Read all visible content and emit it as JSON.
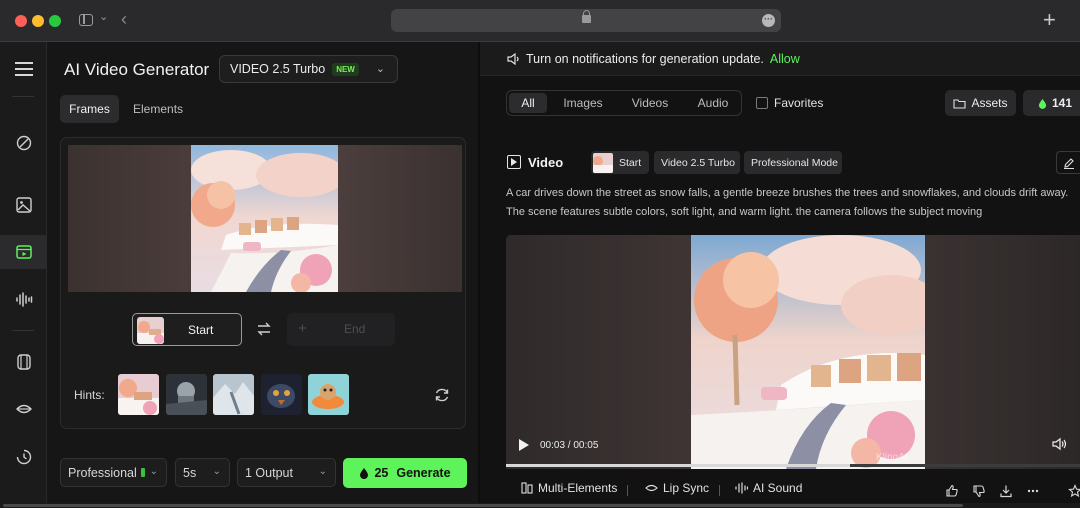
{
  "app": {
    "title": "AI Video Generator",
    "model": "VIDEO 2.5 Turbo",
    "model_badge": "NEW"
  },
  "tabs": [
    "Frames",
    "Elements"
  ],
  "frames": {
    "start_label": "Start",
    "end_label": "End",
    "hints_label": "Hints:"
  },
  "settings": {
    "mode": "Professional",
    "duration": "5s",
    "outputs": "1 Output",
    "generate_cost": "25",
    "generate_label": "Generate"
  },
  "notification": {
    "text": "Turn on notifications for generation update.",
    "action": "Allow"
  },
  "filters": {
    "tabs": [
      "All",
      "Images",
      "Videos",
      "Audio"
    ],
    "active": "All",
    "favorites_label": "Favorites",
    "assets_label": "Assets",
    "credits": "141"
  },
  "result": {
    "heading": "Video",
    "tags": [
      "Start",
      "Video 2.5 Turbo",
      "Professional Mode"
    ],
    "prompt": "A car drives down the street as snow falls, a gentle breeze brushes the trees and snowflakes, and clouds drift away. The scene features subtle colors, soft light, and warm light. the camera follows the subject moving",
    "time": "00:03 / 00:05",
    "progress": 0.6,
    "watermark": "KlingAI",
    "tools": [
      "Multi-Elements",
      "Lip Sync",
      "AI Sound"
    ]
  },
  "colors": {
    "accent": "#5ef25b",
    "background": "#161617",
    "panel": "#121213"
  }
}
